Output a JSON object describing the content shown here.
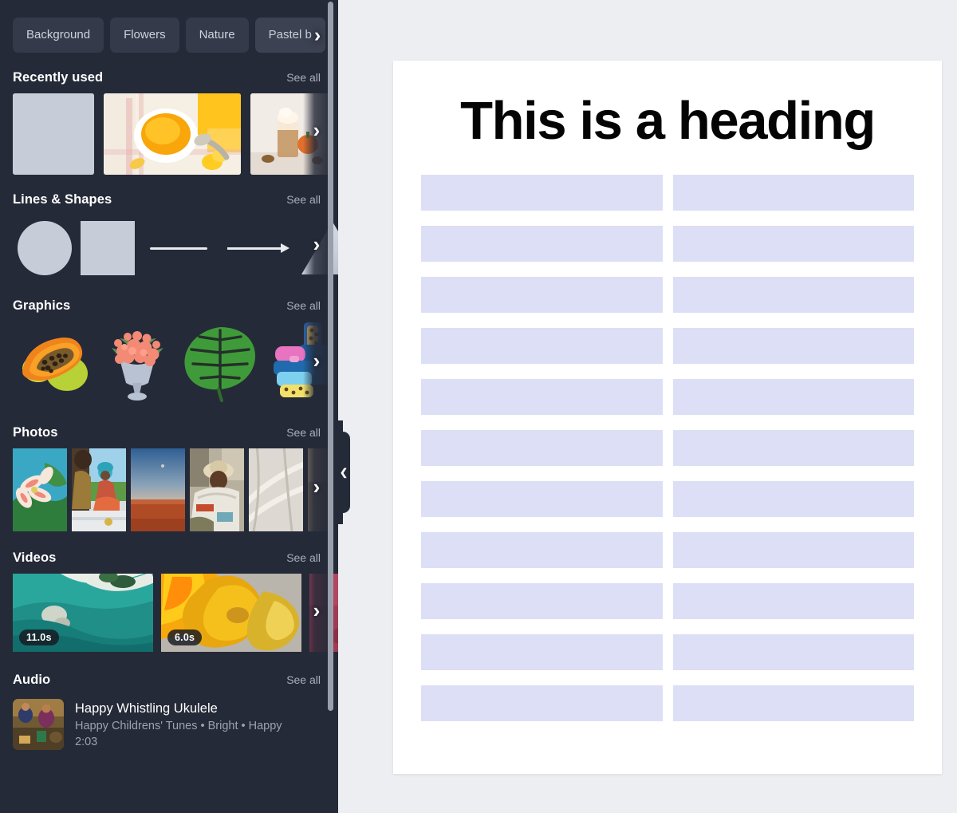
{
  "sidebar": {
    "chips": [
      {
        "label": "Background",
        "selected": false
      },
      {
        "label": "Flowers",
        "selected": false
      },
      {
        "label": "Nature",
        "selected": false
      },
      {
        "label": "Pastel b",
        "selected": true
      }
    ],
    "chips_next_icon": "chevron-right-icon",
    "see_all_label": "See all",
    "next_icon": "chevron-right-icon",
    "sections": [
      {
        "id": "recently-used",
        "title": "Recently used",
        "see_all": "See all",
        "items": [
          {
            "alt": "grey placeholder square"
          },
          {
            "alt": "bowl of pumpkin puree on checkered cloth"
          },
          {
            "alt": "pumpkin spice latte with whipped cream"
          }
        ]
      },
      {
        "id": "lines-and-shapes",
        "title": "Lines & Shapes",
        "see_all": "See all",
        "items": [
          {
            "shape": "circle"
          },
          {
            "shape": "square"
          },
          {
            "shape": "line"
          },
          {
            "shape": "arrow"
          },
          {
            "shape": "triangle"
          }
        ]
      },
      {
        "id": "graphics",
        "title": "Graphics",
        "see_all": "See all",
        "items": [
          {
            "alt": "papaya halves"
          },
          {
            "alt": "bouquet of coral flowers in vase"
          },
          {
            "alt": "monstera leaf"
          },
          {
            "alt": "stacked colorful luggage"
          }
        ]
      },
      {
        "id": "photos",
        "title": "Photos",
        "see_all": "See all",
        "items": [
          {
            "alt": "pink lily flowers against blue sky"
          },
          {
            "alt": "couple having a picnic on grass"
          },
          {
            "alt": "desert horizon under blue sky"
          },
          {
            "alt": "woman in straw hat reading newspaper"
          },
          {
            "alt": "sunlight shadow pattern on wall"
          },
          {
            "alt": "partially visible photo"
          }
        ]
      },
      {
        "id": "videos",
        "title": "Videos",
        "see_all": "See all",
        "items": [
          {
            "alt": "aerial view of turquoise shoreline",
            "duration": "11.0s"
          },
          {
            "alt": "yellow and orange flames close up",
            "duration": "6.0s"
          },
          {
            "alt": "pink toned clip",
            "duration": ""
          }
        ]
      },
      {
        "id": "audio",
        "title": "Audio",
        "see_all": "See all",
        "tracks": [
          {
            "title": "Happy Whistling Ukulele",
            "subtitle": "Happy Childrens' Tunes • Bright • Happy",
            "duration": "2:03",
            "thumb_alt": "children playing outdoors"
          }
        ]
      }
    ],
    "collapse_icon": "chevron-left-icon",
    "scrollbar": "vertical-scrollbar"
  },
  "canvas": {
    "heading": "This is a heading",
    "placeholder_count": 22,
    "placeholder_color": "#dcdff5",
    "page_background": "#ffffff",
    "workspace_background": "#eceef1"
  }
}
